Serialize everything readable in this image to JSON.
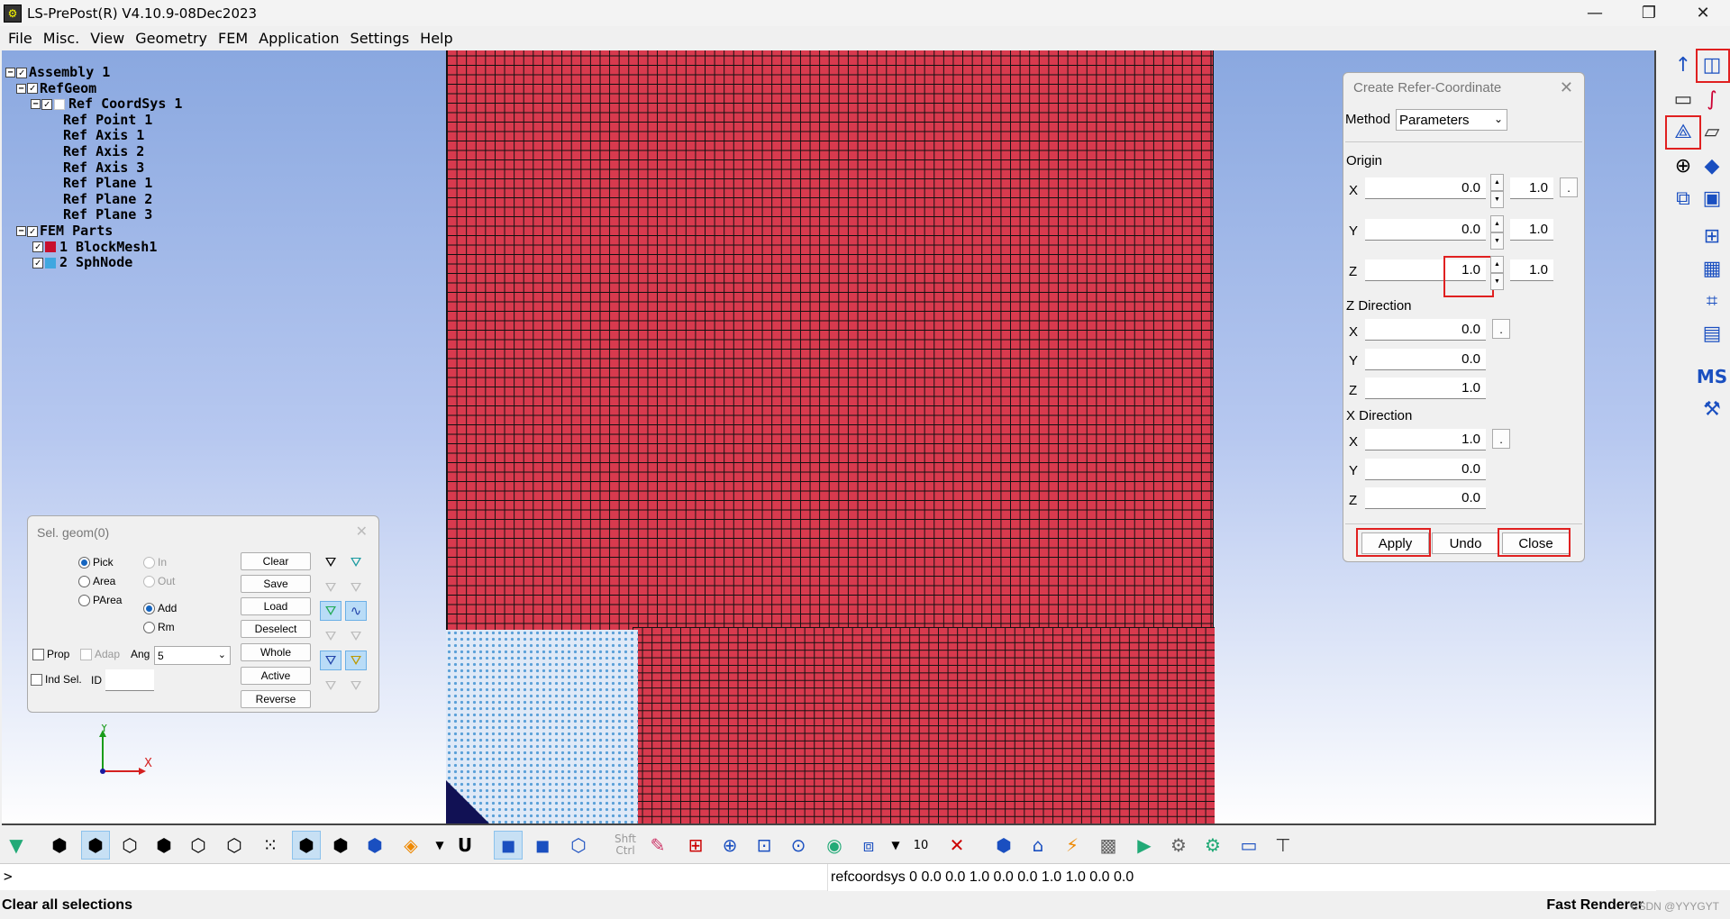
{
  "window": {
    "title": "LS-PrePost(R) V4.10.9-08Dec2023",
    "minimize": "—",
    "restore": "❐",
    "close": "✕"
  },
  "menu": [
    "File",
    "Misc.",
    "View",
    "Geometry",
    "FEM",
    "Application",
    "Settings",
    "Help"
  ],
  "tree": {
    "assembly": "Assembly 1",
    "refgeom": "RefGeom",
    "coordsys": "Ref CoordSys 1",
    "point": "Ref Point 1",
    "axis1": "Ref Axis 1",
    "axis2": "Ref Axis 2",
    "axis3": "Ref Axis 3",
    "plane1": "Ref Plane 1",
    "plane2": "Ref Plane 2",
    "plane3": "Ref Plane 3",
    "fem": "FEM Parts",
    "part1": "1 BlockMesh1",
    "part2": "2 SphNode",
    "part1_color": "#c8102e",
    "part2_color": "#3fa7e0"
  },
  "axis_triad": {
    "y": "Y",
    "x": "X"
  },
  "selgeom": {
    "title": "Sel. geom(0)",
    "close": "✕",
    "pick": "Pick",
    "area": "Area",
    "parea": "PArea",
    "in": "In",
    "out": "Out",
    "add": "Add",
    "rm": "Rm",
    "prop": "Prop",
    "adap": "Adap",
    "ang_label": "Ang",
    "ang_value": "5",
    "ind_sel": "Ind Sel.",
    "id_label": "ID",
    "id_value": "",
    "buttons": [
      "Clear",
      "Save",
      "Load",
      "Deselect",
      "Whole",
      "Active",
      "Reverse"
    ]
  },
  "refcoord": {
    "title": "Create Refer-Coordinate",
    "close": "✕",
    "method_label": "Method",
    "method_value": "Parameters",
    "origin_label": "Origin",
    "origin": [
      {
        "axis": "X",
        "value": "0.0",
        "step": "1.0"
      },
      {
        "axis": "Y",
        "value": "0.0",
        "step": "1.0"
      },
      {
        "axis": "Z",
        "value": "1.0",
        "step": "1.0"
      }
    ],
    "zdir_label": "Z Direction",
    "zdir": [
      {
        "axis": "X",
        "value": "0.0"
      },
      {
        "axis": "Y",
        "value": "0.0"
      },
      {
        "axis": "Z",
        "value": "1.0"
      }
    ],
    "xdir_label": "X Direction",
    "xdir": [
      {
        "axis": "X",
        "value": "1.0"
      },
      {
        "axis": "Y",
        "value": "0.0"
      },
      {
        "axis": "Z",
        "value": "0.0"
      }
    ],
    "dot": ".",
    "apply": "Apply",
    "undo": "Undo",
    "close_btn": "Close"
  },
  "bottom_toolbar": {
    "shft_ctrl": "Shft Ctrl",
    "count": "10",
    "u_label": "U"
  },
  "cmd": {
    "prompt": ">",
    "output": "refcoordsys 0 0.0 0.0 1.0 0.0 0.0 1.0 1.0 0.0 0.0"
  },
  "status": {
    "left": "Clear all selections",
    "right": "Fast Renderer",
    "watermark": "CSDN @YYYGYT"
  },
  "colors": {
    "mesh_red": "#d83a4e",
    "sph_blue": "#5aa0d8",
    "highlight_red": "#e02020"
  }
}
